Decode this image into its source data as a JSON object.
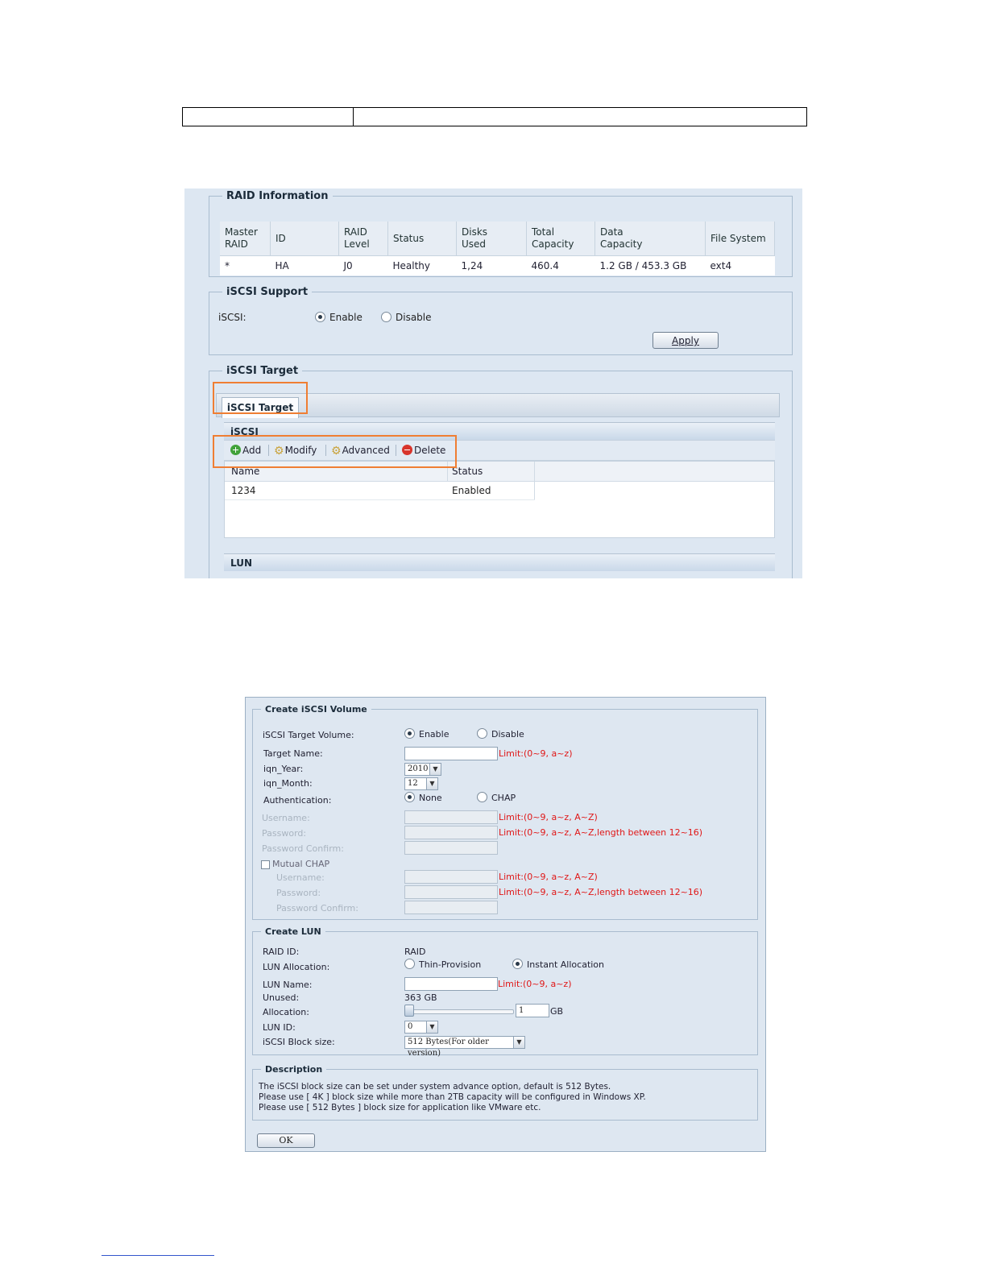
{
  "raid_info": {
    "legend": "RAID Information",
    "headers": [
      [
        "Master",
        "RAID"
      ],
      [
        "ID",
        ""
      ],
      [
        "RAID",
        "Level"
      ],
      [
        "Status",
        ""
      ],
      [
        "Disks",
        "Used"
      ],
      [
        "Total",
        "Capacity"
      ],
      [
        "Data",
        "Capacity"
      ],
      [
        "File System",
        ""
      ]
    ],
    "row": [
      "*",
      "HA",
      "J0",
      "Healthy",
      "1,24",
      "460.4",
      "1.2 GB / 453.3 GB",
      "ext4"
    ]
  },
  "iscsi_support": {
    "legend": "iSCSI Support",
    "label": "iSCSI:",
    "enable": "Enable",
    "disable": "Disable",
    "apply": "Apply"
  },
  "iscsi_target": {
    "legend": "iSCSI Target",
    "tab": "iSCSI Target",
    "panel_title": "iSCSI",
    "toolbar": {
      "add": "Add",
      "modify": "Modify",
      "advanced": "Advanced",
      "delete": "Delete"
    },
    "columns": [
      "Name",
      "Status"
    ],
    "rows": [
      {
        "name": "1234",
        "status": "Enabled"
      }
    ],
    "lun_title": "LUN"
  },
  "create_volume": {
    "legend": "Create iSCSI Volume",
    "target_volume_label": "iSCSI Target Volume:",
    "enable": "Enable",
    "disable": "Disable",
    "target_name_label": "Target Name:",
    "limit_09az": "Limit:(0~9, a~z)",
    "iqn_year_label": "iqn_Year:",
    "iqn_year": "2010",
    "iqn_month_label": "iqn_Month:",
    "iqn_month": "12",
    "auth_label": "Authentication:",
    "auth_none": "None",
    "auth_chap": "CHAP",
    "username_label": "Username:",
    "password_label": "Password:",
    "password_confirm_label": "Password Confirm:",
    "limit_user": "Limit:(0~9, a~z, A~Z)",
    "limit_pass": "Limit:(0~9, a~z, A~Z,length between 12~16)",
    "mutual_chap": "Mutual CHAP"
  },
  "create_lun": {
    "legend": "Create LUN",
    "raid_id_label": "RAID ID:",
    "raid_id": "RAID",
    "alloc_label": "LUN Allocation:",
    "thin": "Thin-Provision",
    "instant": "Instant Allocation",
    "lun_name_label": "LUN Name:",
    "limit": "Limit:(0~9, a~z)",
    "unused_label": "Unused:",
    "unused": "363 GB",
    "allocation_label": "Allocation:",
    "allocation_value": "1",
    "allocation_unit": "GB",
    "lun_id_label": "LUN ID:",
    "lun_id": "0",
    "block_label": "iSCSI Block size:",
    "block_value": "512 Bytes(For older version)"
  },
  "description": {
    "legend": "Description",
    "lines": [
      "The iSCSI block size can be set under system advance option, default is 512 Bytes.",
      "Please use [ 4K ] block size while more than 2TB capacity will be configured in Windows XP.",
      "Please use [ 512 Bytes ] block size for application like VMware etc."
    ]
  },
  "ok": "OK"
}
